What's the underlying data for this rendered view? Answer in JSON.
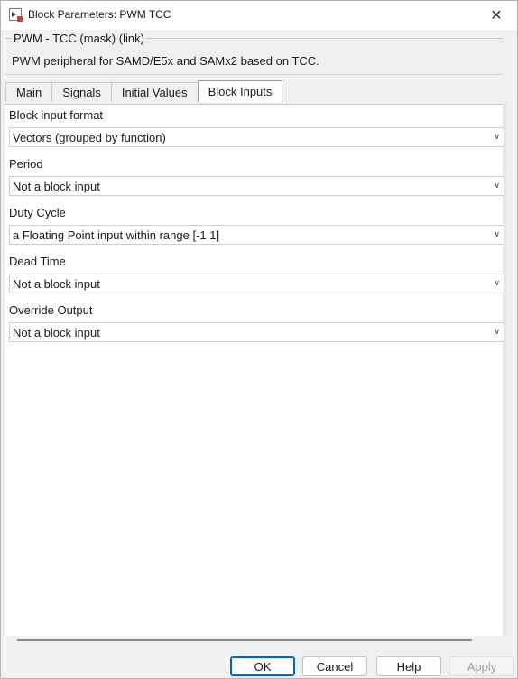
{
  "window": {
    "title": "Block Parameters: PWM TCC",
    "close_symbol": "✕"
  },
  "mask": {
    "title": "PWM - TCC (mask) (link)",
    "description": "PWM peripheral for SAMD/E5x and SAMx2 based on TCC."
  },
  "tabs": [
    {
      "label": "Main"
    },
    {
      "label": "Signals"
    },
    {
      "label": "Initial Values"
    },
    {
      "label": "Block Inputs",
      "active": true
    }
  ],
  "params": [
    {
      "label": "Block input format",
      "value": "Vectors (grouped by function)"
    },
    {
      "label": "Period",
      "value": "Not a block input"
    },
    {
      "label": "Duty Cycle",
      "value": "a Floating Point input within range [-1 1]"
    },
    {
      "label": "Dead Time",
      "value": "Not a block input"
    },
    {
      "label": "Override Output",
      "value": "Not a block input"
    }
  ],
  "buttons": {
    "ok": "OK",
    "cancel": "Cancel",
    "help": "Help",
    "apply": "Apply"
  },
  "icons": {
    "window": "simulink-block-icon",
    "close": "close-icon",
    "dropdown": "chevron-down-icon"
  }
}
